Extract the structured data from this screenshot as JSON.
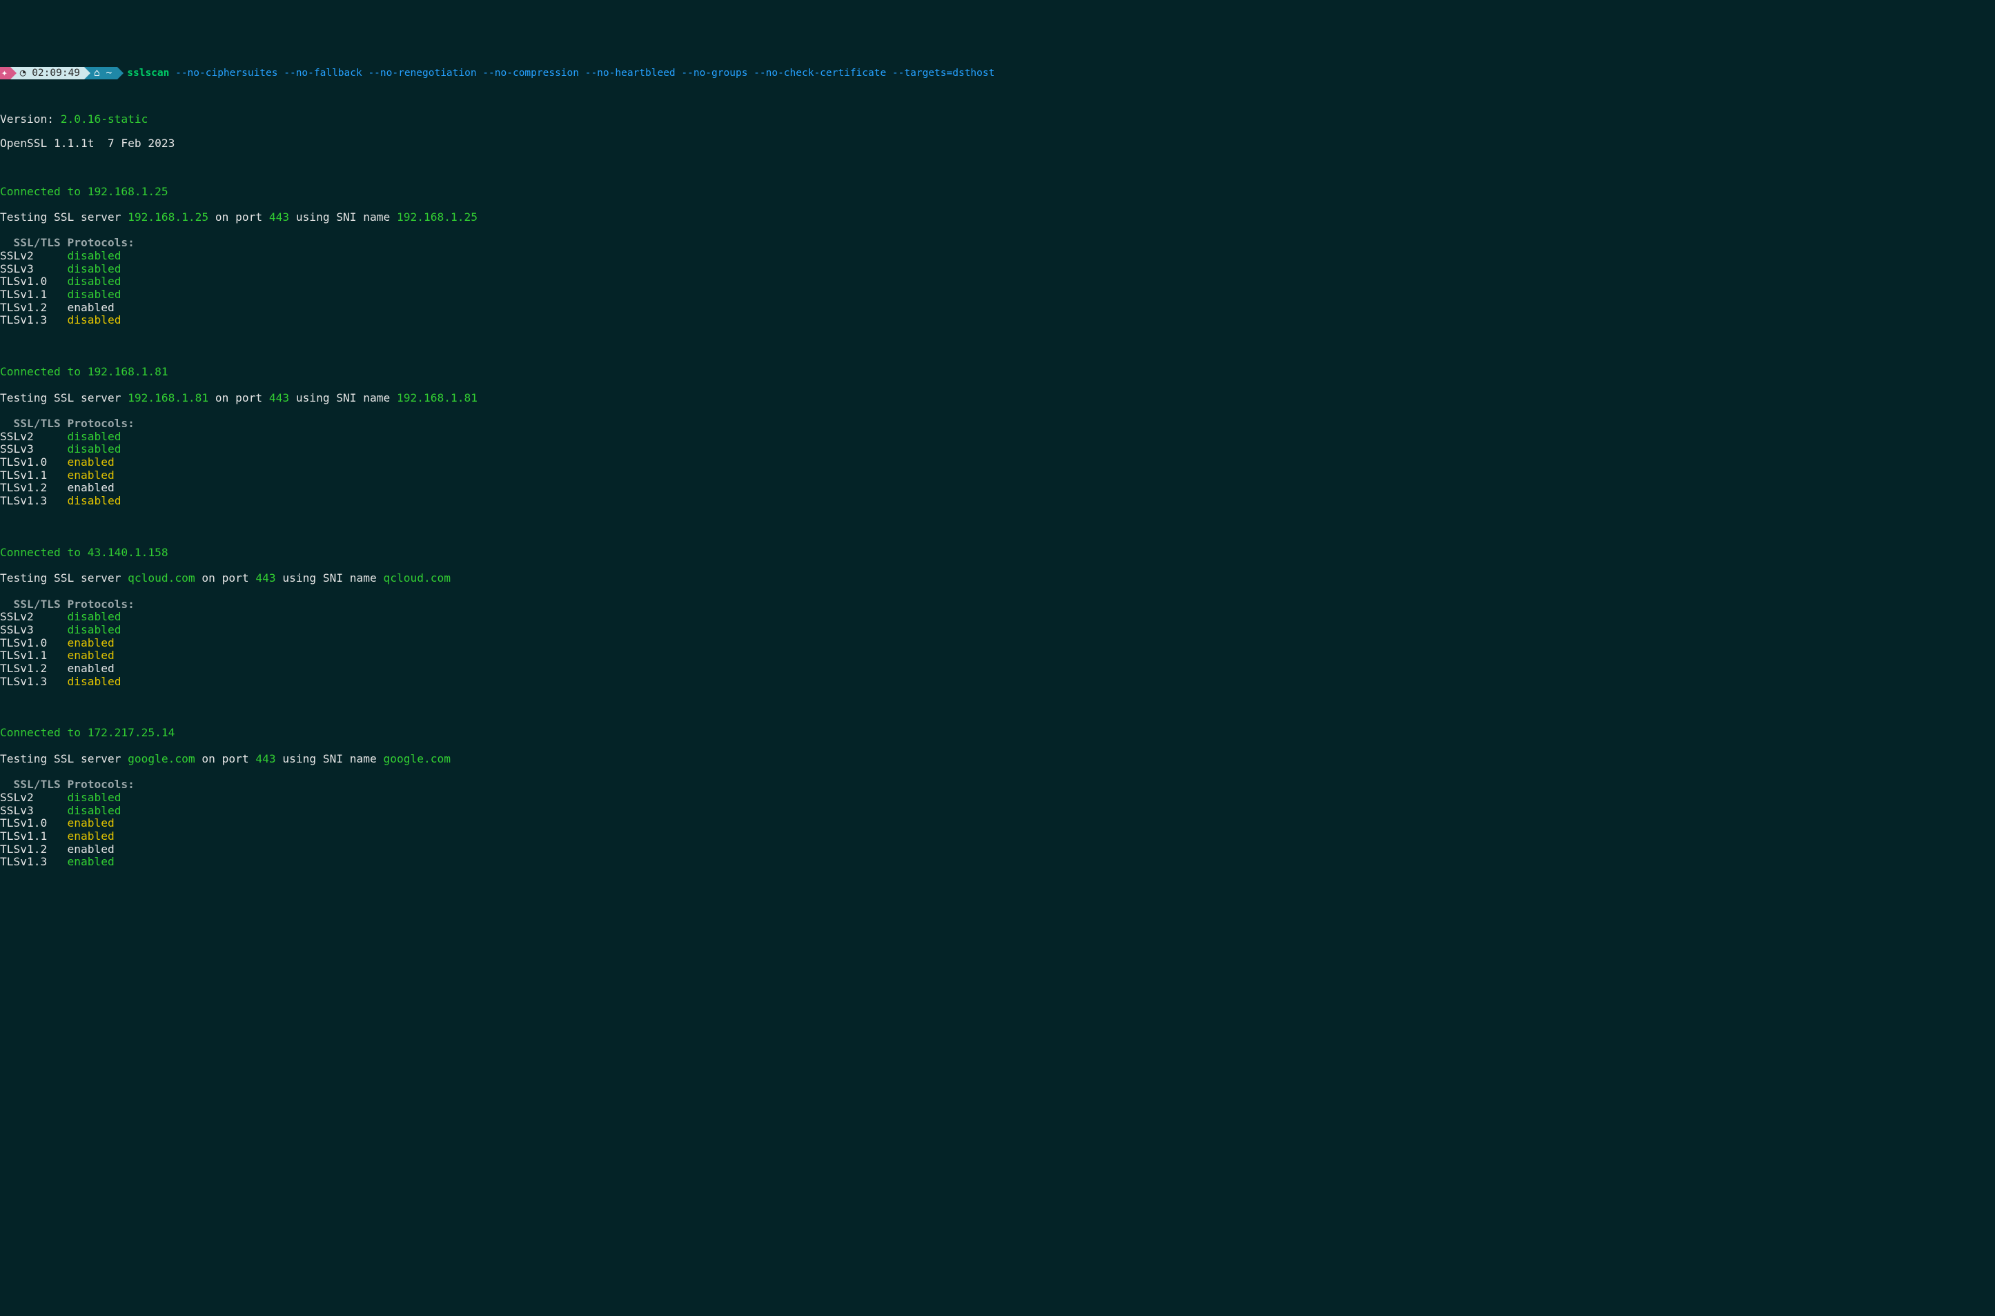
{
  "statusbar": {
    "logo": "✦",
    "clock_icon": "◔",
    "time": "02:09:49",
    "home_icon": "⌂",
    "tilde": "~",
    "prompt_arrow": "▶",
    "command": "sslscan",
    "args": "--no-ciphersuites --no-fallback --no-renegotiation --no-compression --no-heartbleed --no-groups --no-check-certificate --targets=dsthost"
  },
  "header": {
    "version_label": "Version: ",
    "version_value": "2.0.16-static",
    "openssl": "OpenSSL 1.1.1t  7 Feb 2023"
  },
  "hosts": [
    {
      "connected_prefix": "Connected to ",
      "connected_ip": "192.168.1.25",
      "test_prefix": "Testing SSL server ",
      "server": "192.168.1.25",
      "port_prefix": " on port ",
      "port": "443",
      "sni_prefix": " using SNI name ",
      "sni": "192.168.1.25",
      "proto_header": "  SSL/TLS Protocols:",
      "protocols": [
        {
          "name": "SSLv2",
          "status": "disabled",
          "status_class": "c-green"
        },
        {
          "name": "SSLv3",
          "status": "disabled",
          "status_class": "c-green"
        },
        {
          "name": "TLSv1.0",
          "status": "disabled",
          "status_class": "c-green"
        },
        {
          "name": "TLSv1.1",
          "status": "disabled",
          "status_class": "c-green"
        },
        {
          "name": "TLSv1.2",
          "status": "enabled",
          "status_class": "c-white"
        },
        {
          "name": "TLSv1.3",
          "status": "disabled",
          "status_class": "c-yellow"
        }
      ]
    },
    {
      "connected_prefix": "Connected to ",
      "connected_ip": "192.168.1.81",
      "test_prefix": "Testing SSL server ",
      "server": "192.168.1.81",
      "port_prefix": " on port ",
      "port": "443",
      "sni_prefix": " using SNI name ",
      "sni": "192.168.1.81",
      "proto_header": "  SSL/TLS Protocols:",
      "protocols": [
        {
          "name": "SSLv2",
          "status": "disabled",
          "status_class": "c-green"
        },
        {
          "name": "SSLv3",
          "status": "disabled",
          "status_class": "c-green"
        },
        {
          "name": "TLSv1.0",
          "status": "enabled",
          "status_class": "c-yellow"
        },
        {
          "name": "TLSv1.1",
          "status": "enabled",
          "status_class": "c-yellow"
        },
        {
          "name": "TLSv1.2",
          "status": "enabled",
          "status_class": "c-white"
        },
        {
          "name": "TLSv1.3",
          "status": "disabled",
          "status_class": "c-yellow"
        }
      ]
    },
    {
      "connected_prefix": "Connected to ",
      "connected_ip": "43.140.1.158",
      "test_prefix": "Testing SSL server ",
      "server": "qcloud.com",
      "port_prefix": " on port ",
      "port": "443",
      "sni_prefix": " using SNI name ",
      "sni": "qcloud.com",
      "proto_header": "  SSL/TLS Protocols:",
      "protocols": [
        {
          "name": "SSLv2",
          "status": "disabled",
          "status_class": "c-green"
        },
        {
          "name": "SSLv3",
          "status": "disabled",
          "status_class": "c-green"
        },
        {
          "name": "TLSv1.0",
          "status": "enabled",
          "status_class": "c-yellow"
        },
        {
          "name": "TLSv1.1",
          "status": "enabled",
          "status_class": "c-yellow"
        },
        {
          "name": "TLSv1.2",
          "status": "enabled",
          "status_class": "c-white"
        },
        {
          "name": "TLSv1.3",
          "status": "disabled",
          "status_class": "c-yellow"
        }
      ]
    },
    {
      "connected_prefix": "Connected to ",
      "connected_ip": "172.217.25.14",
      "test_prefix": "Testing SSL server ",
      "server": "google.com",
      "port_prefix": " on port ",
      "port": "443",
      "sni_prefix": " using SNI name ",
      "sni": "google.com",
      "proto_header": "  SSL/TLS Protocols:",
      "protocols": [
        {
          "name": "SSLv2",
          "status": "disabled",
          "status_class": "c-green"
        },
        {
          "name": "SSLv3",
          "status": "disabled",
          "status_class": "c-green"
        },
        {
          "name": "TLSv1.0",
          "status": "enabled",
          "status_class": "c-yellow"
        },
        {
          "name": "TLSv1.1",
          "status": "enabled",
          "status_class": "c-yellow"
        },
        {
          "name": "TLSv1.2",
          "status": "enabled",
          "status_class": "c-white"
        },
        {
          "name": "TLSv1.3",
          "status": "enabled",
          "status_class": "c-green"
        }
      ]
    }
  ]
}
